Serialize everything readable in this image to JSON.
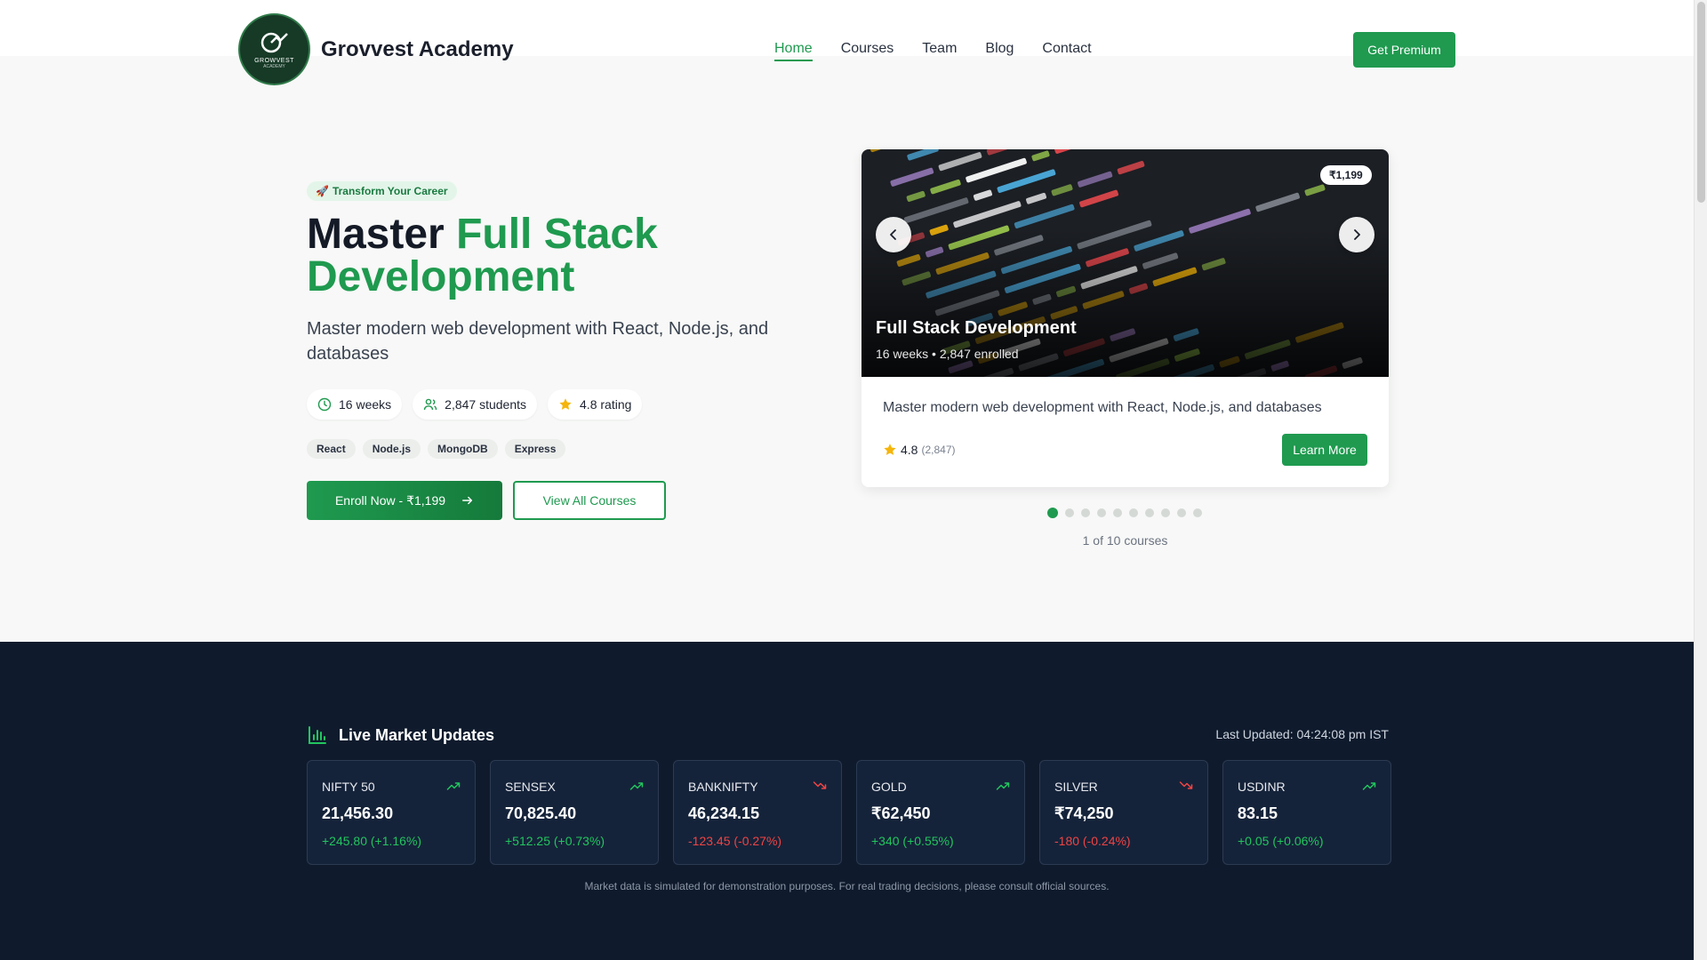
{
  "header": {
    "brand": "Grovvest Academy",
    "logo_text": "GROWVEST",
    "logo_sub": "ACADEMY",
    "nav": [
      {
        "label": "Home",
        "active": true
      },
      {
        "label": "Courses",
        "active": false
      },
      {
        "label": "Team",
        "active": false
      },
      {
        "label": "Blog",
        "active": false
      },
      {
        "label": "Contact",
        "active": false
      }
    ],
    "premium_label": "Get Premium"
  },
  "hero": {
    "badge_icon": "🚀",
    "badge": "Transform Your Career",
    "title_prefix": "Master",
    "title_accent": "Full Stack Development",
    "subtitle": "Master modern web development with React, Node.js, and databases",
    "stats": [
      {
        "icon": "clock-icon",
        "label": "16 weeks"
      },
      {
        "icon": "users-icon",
        "label": "2,847 students"
      },
      {
        "icon": "star-icon",
        "label": "4.8 rating"
      }
    ],
    "tags": [
      "React",
      "Node.js",
      "MongoDB",
      "Express"
    ],
    "enroll_label": "Enroll Now - ₹1,199",
    "view_all_label": "View All Courses"
  },
  "carousel": {
    "price": "₹1,199",
    "title": "Full Stack Development",
    "meta": "16 weeks • 2,847 enrolled",
    "description": "Master modern web development with React, Node.js, and databases",
    "rating": "4.8",
    "rating_count": "(2,847)",
    "learn_more_label": "Learn More",
    "total": 10,
    "active_index": 0,
    "counter": "1 of 10 courses"
  },
  "market": {
    "title": "Live Market Updates",
    "last_updated": "Last Updated: 04:24:08 pm IST",
    "tickers": [
      {
        "name": "NIFTY 50",
        "price": "21,456.30",
        "change": "+245.80 (+1.16%)",
        "trend": "up"
      },
      {
        "name": "SENSEX",
        "price": "70,825.40",
        "change": "+512.25 (+0.73%)",
        "trend": "up"
      },
      {
        "name": "BANKNIFTY",
        "price": "46,234.15",
        "change": "-123.45 (-0.27%)",
        "trend": "down"
      },
      {
        "name": "GOLD",
        "price": "₹62,450",
        "change": "+340 (+0.55%)",
        "trend": "up"
      },
      {
        "name": "SILVER",
        "price": "₹74,250",
        "change": "-180 (-0.24%)",
        "trend": "down"
      },
      {
        "name": "USDINR",
        "price": "83.15",
        "change": "+0.05 (+0.06%)",
        "trend": "up"
      }
    ],
    "disclaimer": "Market data is simulated for demonstration purposes. For real trading decisions, please consult official sources."
  },
  "colors": {
    "brand_green": "#1f9a4f",
    "market_bg": "#0f1b2d",
    "up": "#22c55e",
    "down": "#ef4444"
  }
}
